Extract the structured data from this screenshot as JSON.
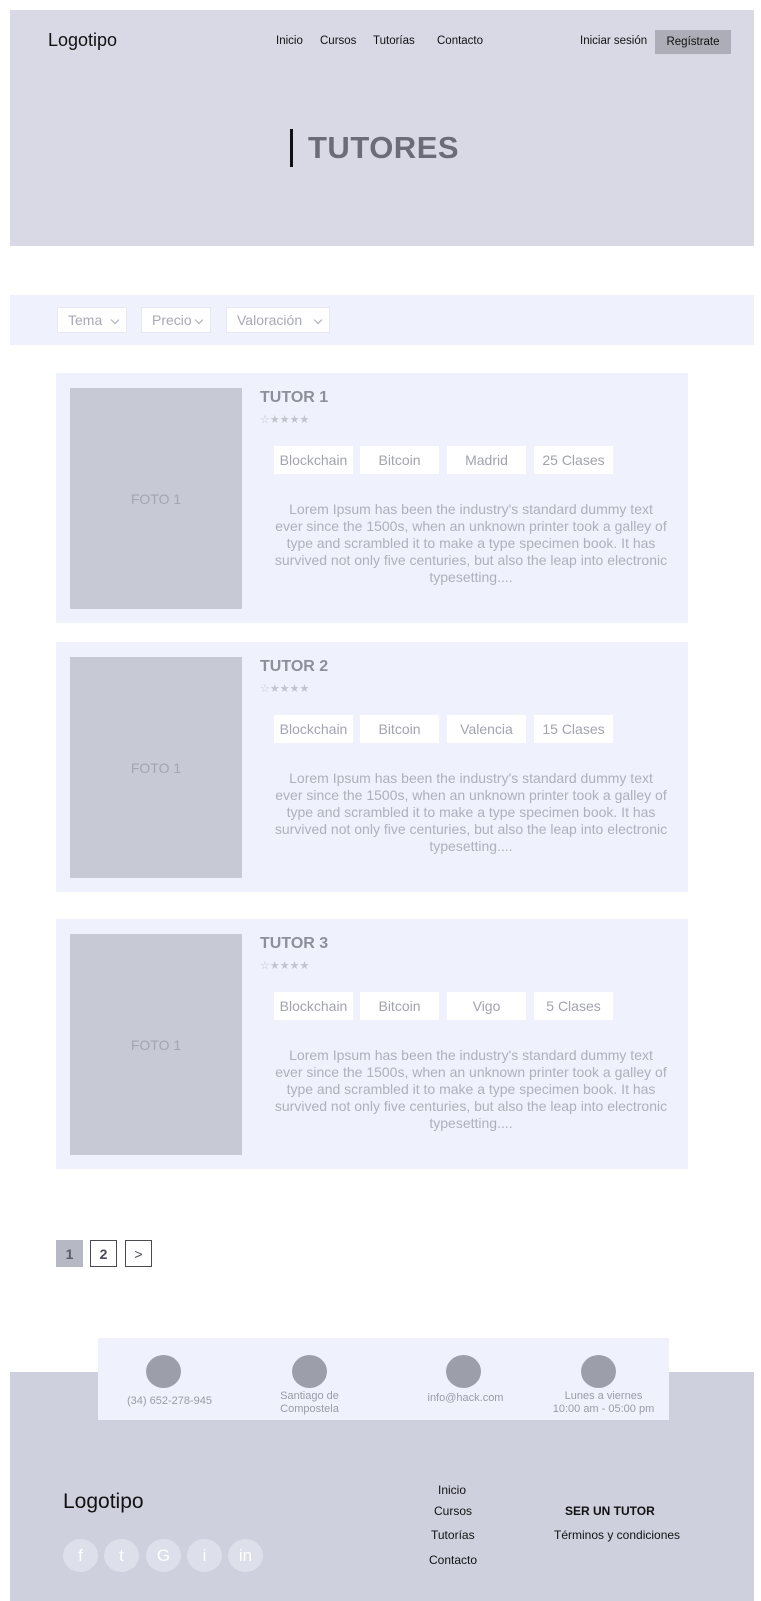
{
  "header": {
    "logo": "Logotipo",
    "nav": [
      "Inicio",
      "Cursos",
      "Tutorías",
      "Contacto"
    ],
    "login": "Iniciar sesión",
    "register": "Regístrate",
    "title": "TUTORES"
  },
  "filters": [
    "Tema",
    "Precio",
    "Valoración"
  ],
  "tutors": [
    {
      "name": "TUTOR 1",
      "stars": "☆★★★★",
      "photo": "FOTO 1",
      "tags": [
        "Blockchain",
        "Bitcoin",
        "Madrid",
        "25 Clases"
      ],
      "description": "Lorem Ipsum has been the industry's standard dummy text ever since the 1500s, when an unknown printer took a galley of type and scrambled it to make a type specimen book. It has survived not only five centuries, but also the leap into electronic typesetting...."
    },
    {
      "name": "TUTOR 2",
      "stars": "☆★★★★",
      "photo": "FOTO 1",
      "tags": [
        "Blockchain",
        "Bitcoin",
        "Valencia",
        "15 Clases"
      ],
      "description": "Lorem Ipsum has been the industry's standard dummy text ever since the 1500s, when an unknown printer took a galley of type and scrambled it to make a type specimen book. It has survived not only five centuries, but also the leap into electronic typesetting...."
    },
    {
      "name": "TUTOR 3",
      "stars": "☆★★★★",
      "photo": "FOTO 1",
      "tags": [
        "Blockchain",
        "Bitcoin",
        "Vigo",
        "5 Clases"
      ],
      "description": "Lorem Ipsum has been the industry's standard dummy text ever since the 1500s, when an unknown printer took a galley of type and scrambled it to make a type specimen book. It has survived not only five centuries, but also the leap into electronic typesetting...."
    }
  ],
  "pagination": {
    "pages": [
      "1",
      "2"
    ],
    "current": "1",
    "next": ">"
  },
  "contact": {
    "phone": "(34) 652-278-945",
    "city_line1": "Santiago de",
    "city_line2": "Compostela",
    "email": "info@hack.com",
    "hours_line1": "Lunes a viernes",
    "hours_line2": "10:00 am - 05:00 pm"
  },
  "footer": {
    "logo": "Logotipo",
    "social": [
      "f",
      "t",
      "G",
      "i",
      "in"
    ],
    "links": [
      "Inicio",
      "Cursos",
      "Tutorías",
      "Contacto"
    ],
    "tutor_heading": "SER UN TUTOR",
    "terms": "Términos y condiciones"
  }
}
